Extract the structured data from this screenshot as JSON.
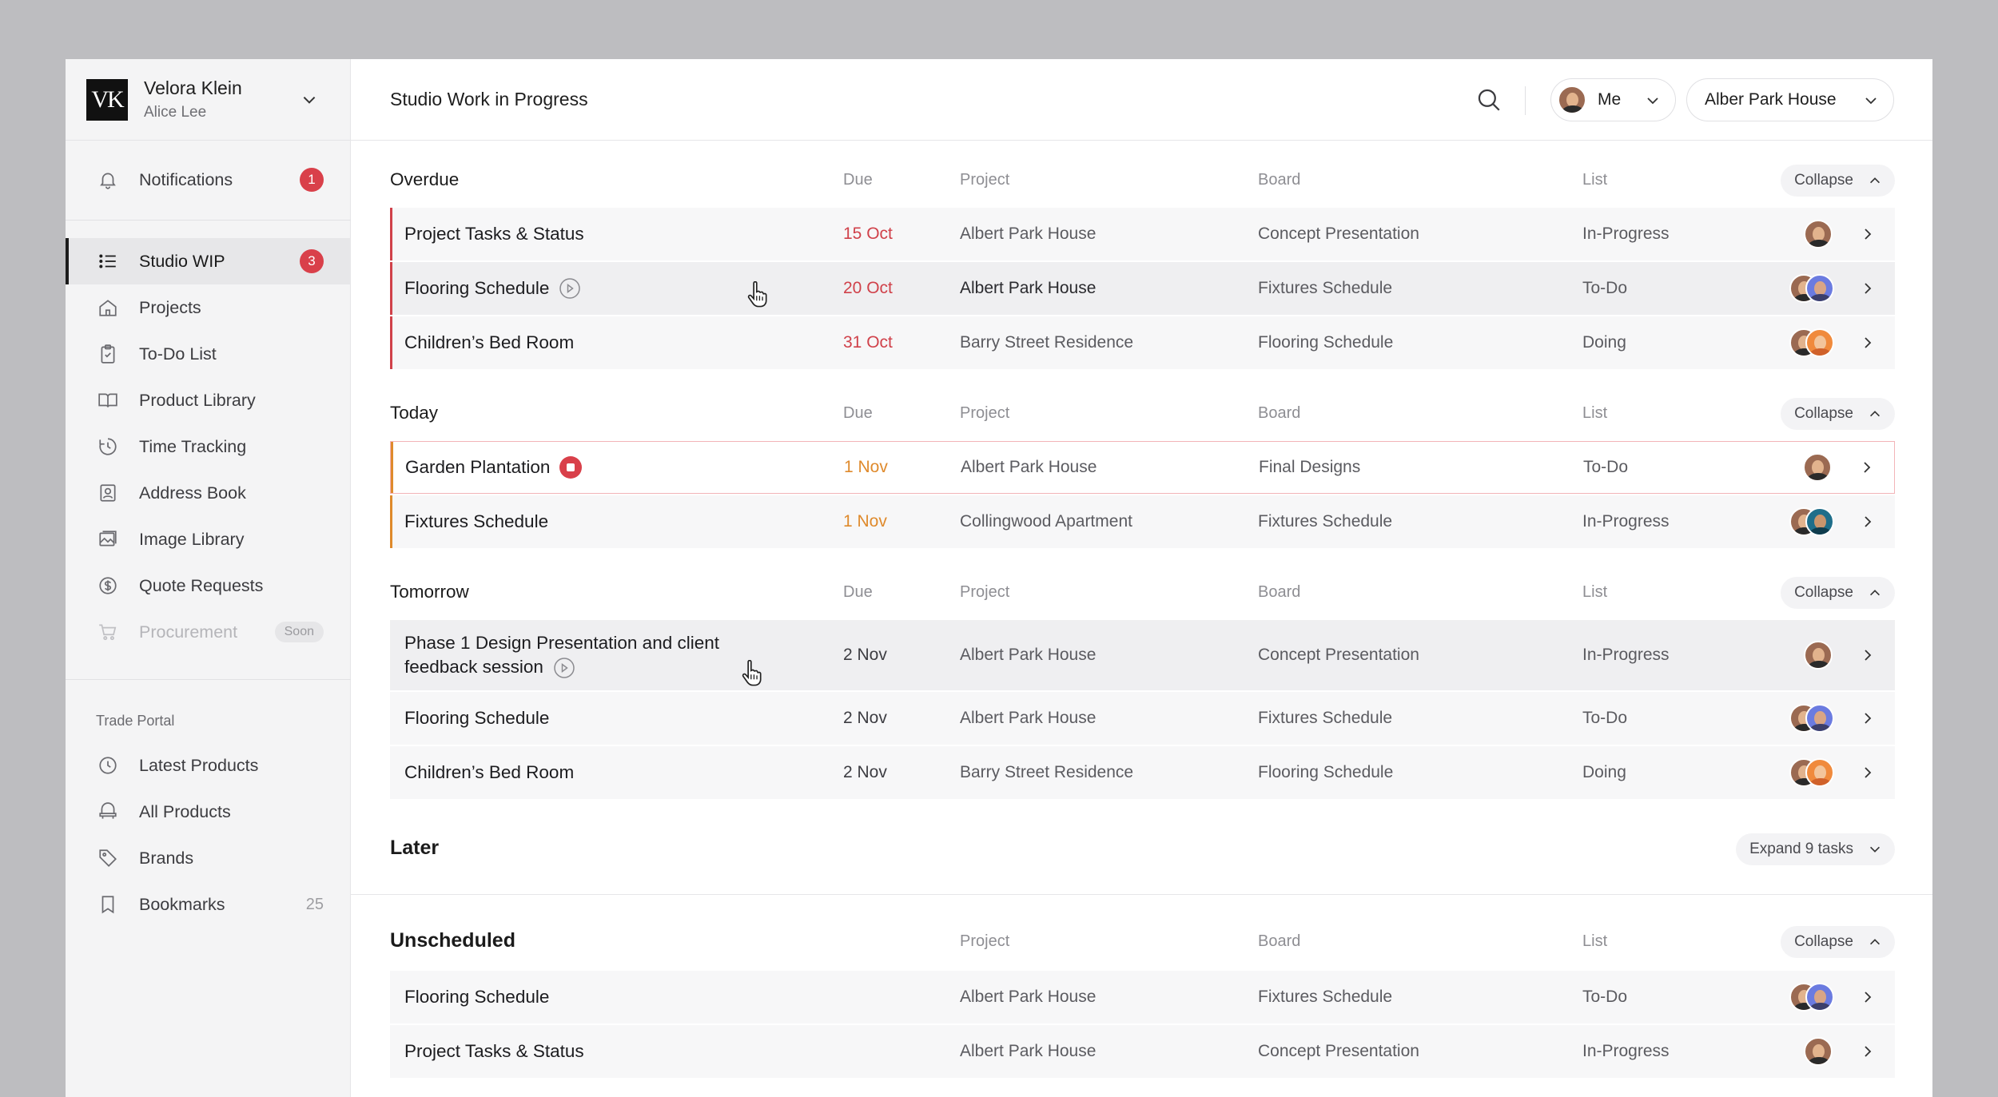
{
  "account": {
    "initials": "VK",
    "name": "Velora Klein",
    "user": "Alice Lee"
  },
  "sidebar": {
    "notifications": {
      "label": "Notifications",
      "badge": "1"
    },
    "items": [
      {
        "label": "Studio WIP",
        "badge": "3",
        "icon": "list-icon"
      },
      {
        "label": "Projects",
        "icon": "home-icon"
      },
      {
        "label": "To-Do List",
        "icon": "clipboard-check-icon"
      },
      {
        "label": "Product Library",
        "icon": "book-icon"
      },
      {
        "label": "Time Tracking",
        "icon": "clock-icon"
      },
      {
        "label": "Address Book",
        "icon": "contact-icon"
      },
      {
        "label": "Image Library",
        "icon": "image-icon"
      },
      {
        "label": "Quote Requests",
        "icon": "dollar-icon"
      },
      {
        "label": "Procurement",
        "tag": "Soon",
        "icon": "cart-icon"
      }
    ],
    "trade_section": "Trade Portal",
    "trade_items": [
      {
        "label": "Latest Products",
        "icon": "clock-icon"
      },
      {
        "label": "All Products",
        "icon": "chair-icon"
      },
      {
        "label": "Brands",
        "icon": "tag-icon"
      },
      {
        "label": "Bookmarks",
        "count": "25",
        "icon": "bookmark-icon"
      }
    ]
  },
  "header": {
    "title": "Studio Work in Progress",
    "filter_user": "Me",
    "filter_project": "Alber Park House"
  },
  "columns": {
    "due": "Due",
    "project": "Project",
    "board": "Board",
    "list": "List"
  },
  "sections": {
    "overdue": {
      "title": "Overdue",
      "action": "Collapse",
      "rows": [
        {
          "task": "Project Tasks & Status",
          "due": "15 Oct",
          "project": "Albert Park House",
          "board": "Concept Presentation",
          "list": "In-Progress"
        },
        {
          "task": "Flooring Schedule",
          "due": "20 Oct",
          "project": "Albert Park House",
          "board": "Fixtures Schedule",
          "list": "To-Do"
        },
        {
          "task": "Children’s Bed Room",
          "due": "31 Oct",
          "project": "Barry Street Residence",
          "board": "Flooring Schedule",
          "list": "Doing"
        }
      ]
    },
    "today": {
      "title": "Today",
      "action": "Collapse",
      "rows": [
        {
          "task": "Garden Plantation",
          "due": "1 Nov",
          "project": "Albert Park House",
          "board": "Final Designs",
          "list": "To-Do"
        },
        {
          "task": "Fixtures Schedule",
          "due": "1 Nov",
          "project": "Collingwood Apartment",
          "board": "Fixtures Schedule",
          "list": "In-Progress"
        }
      ]
    },
    "tomorrow": {
      "title": "Tomorrow",
      "action": "Collapse",
      "rows": [
        {
          "task_line1": "Phase 1 Design Presentation and client",
          "task_line2": "feedback session",
          "due": "2 Nov",
          "project": "Albert Park House",
          "board": "Concept Presentation",
          "list": "In-Progress"
        },
        {
          "task": "Flooring Schedule",
          "due": "2 Nov",
          "project": "Albert Park House",
          "board": "Fixtures Schedule",
          "list": "To-Do"
        },
        {
          "task": "Children’s Bed Room",
          "due": "2 Nov",
          "project": "Barry Street Residence",
          "board": "Flooring Schedule",
          "list": "Doing"
        }
      ]
    },
    "later": {
      "title": "Later",
      "action": "Expand 9 tasks"
    },
    "unscheduled": {
      "title": "Unscheduled",
      "action": "Collapse",
      "rows": [
        {
          "task": "Flooring Schedule",
          "project": "Albert Park House",
          "board": "Fixtures Schedule",
          "list": "To-Do"
        },
        {
          "task": "Project Tasks & Status",
          "project": "Albert Park House",
          "board": "Concept Presentation",
          "list": "In-Progress"
        }
      ]
    }
  },
  "colors": {
    "overdue": "#d0414a",
    "today": "#df8a2c",
    "badge": "#d9404a"
  }
}
